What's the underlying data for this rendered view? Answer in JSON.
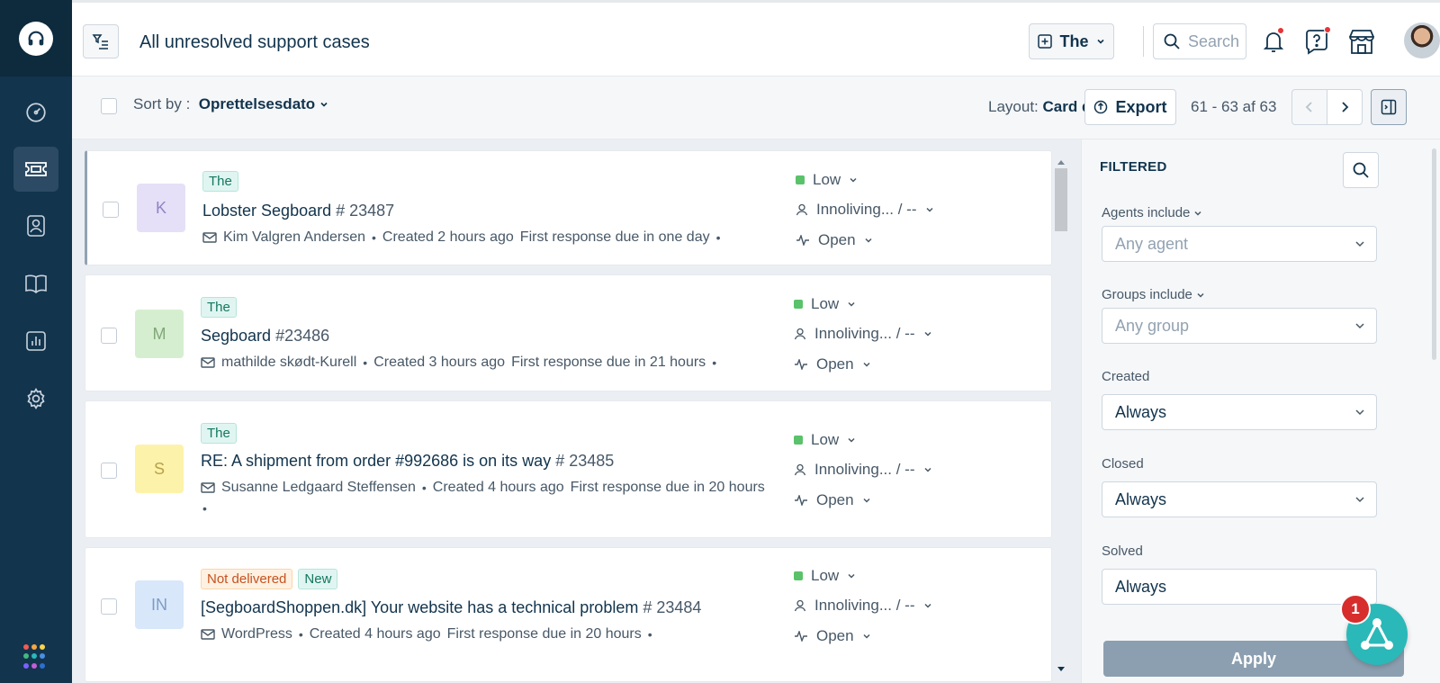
{
  "header": {
    "title": "All unresolved support cases",
    "new_button_label": "The",
    "search_placeholder": "Search"
  },
  "toolbar": {
    "sort_by_label": "Sort by :",
    "sort_by_value": "Oprettelsesdato",
    "layout_label": "Layout:",
    "layout_value": "Card display",
    "export_label": "Export",
    "pagination": "61 - 63 af 63"
  },
  "tickets": [
    {
      "avatar_letter": "K",
      "avatar_bg": "#e5e0f7",
      "avatar_fg": "#8f86c4",
      "tags": [
        {
          "text": "The",
          "style": "green"
        }
      ],
      "title": "Lobster Segboard",
      "number": "# 23487",
      "requester": "Kim Valgren Andersen",
      "created": "Created 2 hours ago",
      "due": "First response due in one day",
      "priority": "Low",
      "assignee": "Innoliving... / --",
      "status": "Open"
    },
    {
      "avatar_letter": "M",
      "avatar_bg": "#d6eed0",
      "avatar_fg": "#7fa877",
      "tags": [
        {
          "text": "The",
          "style": "green"
        }
      ],
      "title": "Segboard",
      "number": "#23486",
      "requester": "mathilde skødt-Kurell",
      "created": "Created 3 hours ago",
      "due": "First response due in 21 hours",
      "priority": "Low",
      "assignee": "Innoliving... / --",
      "status": "Open"
    },
    {
      "avatar_letter": "S",
      "avatar_bg": "#fdf2a9",
      "avatar_fg": "#b6a24c",
      "tags": [
        {
          "text": "The",
          "style": "green"
        }
      ],
      "title": "RE: A shipment from order #992686 is on its way",
      "number": "# 23485",
      "requester": "Susanne Ledgaard Steffensen",
      "created": "Created 4 hours ago",
      "due": "First response due in 20 hours",
      "priority": "Low",
      "assignee": "Innoliving... / --",
      "status": "Open"
    },
    {
      "avatar_letter": "IN",
      "avatar_bg": "#d8e7fa",
      "avatar_fg": "#7e9cc6",
      "tags": [
        {
          "text": "Not delivered",
          "style": "orange"
        },
        {
          "text": "New",
          "style": "green"
        }
      ],
      "title": "[SegboardShoppen.dk] Your website has a technical problem",
      "number": "# 23484",
      "requester": "WordPress",
      "created": "Created 4 hours ago",
      "due": "First response due in 20 hours",
      "priority": "Low",
      "assignee": "Innoliving... / --",
      "status": "Open"
    }
  ],
  "filters": {
    "title": "FILTERED",
    "agents_label": "Agents include",
    "agents_placeholder": "Any agent",
    "groups_label": "Groups include",
    "groups_placeholder": "Any group",
    "created_label": "Created",
    "created_value": "Always",
    "closed_label": "Closed",
    "closed_value": "Always",
    "solved_label": "Solved",
    "solved_value": "Always",
    "apply_label": "Apply"
  },
  "widget": {
    "badge_count": "1"
  },
  "colors": {
    "rail": "#12344d",
    "accent_teal": "#2bb8b8",
    "priority_low": "#5ac26a",
    "badge_red": "#d72d2d"
  }
}
